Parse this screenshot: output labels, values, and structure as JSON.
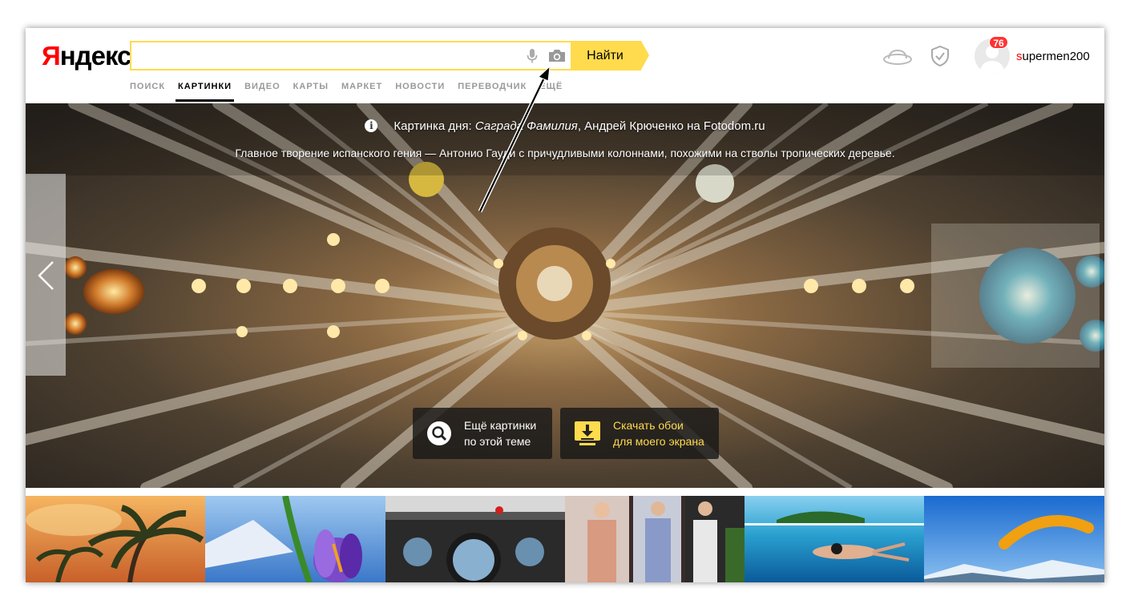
{
  "header": {
    "logo_first": "Я",
    "logo_rest": "ндекс",
    "search_value": "",
    "find_button": "Найти",
    "tabs": [
      {
        "label": "ПОИСК",
        "active": false
      },
      {
        "label": "КАРТИНКИ",
        "active": true
      },
      {
        "label": "ВИДЕО",
        "active": false
      },
      {
        "label": "КАРТЫ",
        "active": false
      },
      {
        "label": "МАРКЕТ",
        "active": false
      },
      {
        "label": "НОВОСТИ",
        "active": false
      },
      {
        "label": "ПЕРЕВОДЧИК",
        "active": false
      },
      {
        "label": "ЕЩЁ",
        "active": false
      }
    ],
    "user": {
      "badge_count": "76",
      "name_first": "s",
      "name_rest": "upermen200"
    }
  },
  "hero": {
    "caption_prefix": "Картинка дня: ",
    "caption_italic": "Саграда Фамилия",
    "caption_suffix": ", Андрей Крюченко на Fotodom.ru",
    "description": "Главное творение испанского гения — Антонио Гауди с причудливыми колоннами, похожими на стволы тропических деревье.",
    "more_line1": "Ещё картинки",
    "more_line2": "по этой теме",
    "download_line1": "Скачать обои",
    "download_line2": "для моего экрана"
  },
  "thumbnails": [
    {
      "name": "palm-sunset",
      "color": "#e8903a"
    },
    {
      "name": "crocus-flower",
      "color": "#7f5dc0"
    },
    {
      "name": "space-station",
      "color": "#3a3a3a"
    },
    {
      "name": "fashion-models",
      "color": "#b79a8c"
    },
    {
      "name": "underwater-swimmer",
      "color": "#1e8fc0"
    },
    {
      "name": "paraglider",
      "color": "#2a78c9"
    }
  ],
  "colors": {
    "accent_yellow": "#ffdb4d",
    "logo_red": "#ff0000",
    "badge_red": "#ff3333"
  }
}
